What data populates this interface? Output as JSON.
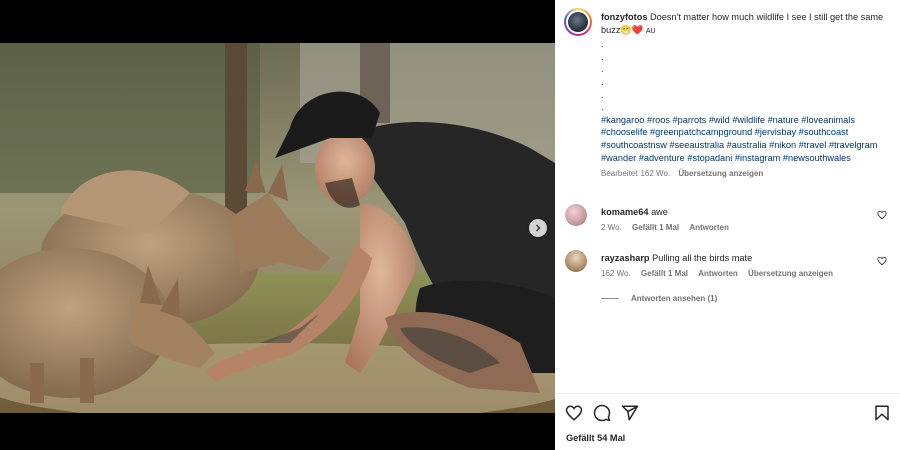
{
  "post": {
    "username": "fonzyfotos",
    "caption_text": "Doesn't matter how much wildlife I see I still get the same buzz",
    "caption_emoji": "😁❤️",
    "caption_suffix": "AU",
    "dots": [
      ".",
      ".",
      ".",
      ".",
      ".",
      "."
    ],
    "hashtags": [
      "#kangaroo",
      "#roos",
      "#parrots",
      "#wild",
      "#wildlife",
      "#nature",
      "#loveanimals",
      "#chooselife",
      "#greenpatchcampground",
      "#jervisbay",
      "#southcoast",
      "#southcoastnsw",
      "#seeaustralia",
      "#australia",
      "#nikon",
      "#travel",
      "#travelgram",
      "#wander",
      "#adventure",
      "#stopadani",
      "#instagram",
      "#newsouthwales"
    ],
    "edited_label": "Bearbeitet",
    "age": "162 Wo.",
    "translate_label": "Übersetzung anzeigen",
    "likes_label": "Gefällt 54 Mal"
  },
  "comments": [
    {
      "username": "komame64",
      "text": "awe",
      "age": "2 Wo.",
      "likes": "Gefällt 1 Mal",
      "reply": "Antworten"
    },
    {
      "username": "rayzasharp",
      "text": "Pulling all the birds mate",
      "age": "162 Wo.",
      "likes": "Gefällt 1 Mal",
      "reply": "Antworten",
      "translate": "Übersetzung anzeigen"
    }
  ],
  "view_replies_label": "Antworten ansehen (1)",
  "icons": {
    "like": "heart-icon",
    "comment": "comment-icon",
    "share": "share-icon",
    "save": "bookmark-icon",
    "next": "chevron-right-icon"
  }
}
